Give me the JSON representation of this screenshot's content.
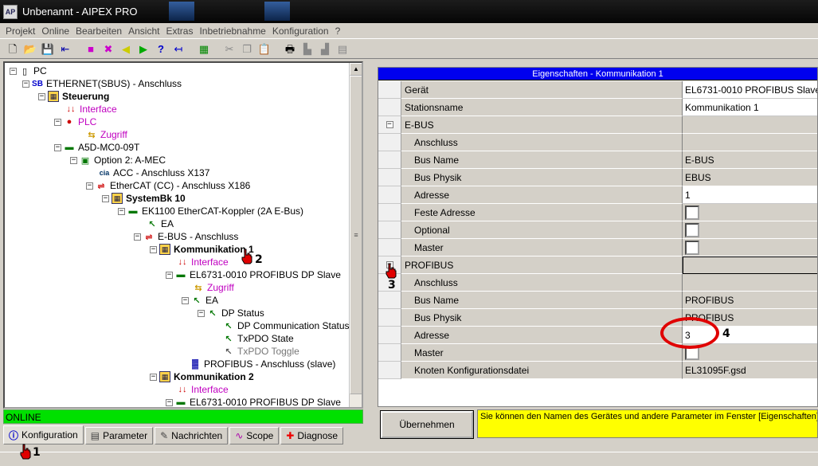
{
  "window": {
    "title": "Unbenannt - AIPEX PRO",
    "app_icon": "AP"
  },
  "menu": [
    "Projekt",
    "Online",
    "Bearbeiten",
    "Ansicht",
    "Extras",
    "Inbetriebnahme",
    "Konfiguration",
    "?"
  ],
  "toolbar_icons": [
    "new-icon",
    "open-icon",
    "save-icon",
    "import-icon",
    "disk-magenta-icon",
    "delete-icon",
    "arrow-left-icon",
    "arrow-right-icon",
    "help-icon",
    "cut-arrow-icon",
    "calculator-icon",
    "scissors-icon",
    "copy-icon",
    "paste-icon",
    "print-icon",
    "align-icon",
    "align2-icon",
    "align3-icon"
  ],
  "tree": [
    {
      "label": "PC",
      "icon": "pc-icon"
    },
    {
      "label": "ETHERNET(SBUS) - Anschluss",
      "icon": "sb-icon"
    },
    {
      "label": "Steuerung",
      "icon": "controller-icon"
    },
    {
      "label": "Interface",
      "icon": "interface-icon"
    },
    {
      "label": "PLC",
      "icon": "plc-icon"
    },
    {
      "label": "Zugriff",
      "icon": "access-icon"
    },
    {
      "label": "A5D-MC0-09T",
      "icon": "module-icon"
    },
    {
      "label": "Option 2: A-MEC",
      "icon": "option-icon"
    },
    {
      "label": "ACC - Anschluss X137",
      "icon": "cia-icon"
    },
    {
      "label": "EtherCAT (CC) - Anschluss X186",
      "icon": "ethercat-icon"
    },
    {
      "label": "SystemBk 10",
      "icon": "systembk-icon"
    },
    {
      "label": "EK1100 EtherCAT-Koppler (2A E-Bus)",
      "icon": "module-icon"
    },
    {
      "label": "EA",
      "icon": "io-icon"
    },
    {
      "label": "E-BUS - Anschluss",
      "icon": "ebus-icon"
    },
    {
      "label": "Kommunikation 1",
      "icon": "controller-icon"
    },
    {
      "label": "Interface",
      "icon": "interface-icon"
    },
    {
      "label": "EL6731-0010 PROFIBUS DP Slave",
      "icon": "module-icon"
    },
    {
      "label": "Zugriff",
      "icon": "access-icon"
    },
    {
      "label": "EA",
      "icon": "io-icon"
    },
    {
      "label": "DP Status",
      "icon": "io-icon"
    },
    {
      "label": "DP Communication Status",
      "icon": "io-icon"
    },
    {
      "label": "TxPDO State",
      "icon": "io-icon"
    },
    {
      "label": "TxPDO Toggle",
      "icon": "io-icon"
    },
    {
      "label": "PROFIBUS - Anschluss  (slave)",
      "icon": "profibus-icon"
    },
    {
      "label": "Kommunikation 2",
      "icon": "controller-icon"
    },
    {
      "label": "Interface",
      "icon": "interface-icon"
    },
    {
      "label": "EL6731-0010 PROFIBUS DP Slave",
      "icon": "module-icon"
    }
  ],
  "status": "ONLINE",
  "tabs": [
    {
      "label": "Konfiguration",
      "icon": "info-icon",
      "active": true
    },
    {
      "label": "Parameter",
      "icon": "parameter-icon",
      "active": false
    },
    {
      "label": "Nachrichten",
      "icon": "messages-icon",
      "active": false
    },
    {
      "label": "Scope",
      "icon": "scope-icon",
      "active": false
    },
    {
      "label": "Diagnose",
      "icon": "diagnose-icon",
      "active": false
    }
  ],
  "properties": {
    "title": "Eigenschaften - Kommunikation 1",
    "rows": [
      {
        "label": "Gerät",
        "value": "EL6731-0010 PROFIBUS Slave"
      },
      {
        "label": "Stationsname",
        "value": "Kommunikation 1"
      },
      {
        "label": "E-BUS",
        "value": ""
      },
      {
        "label": "Anschluss",
        "value": ""
      },
      {
        "label": "Bus Name",
        "value": "E-BUS"
      },
      {
        "label": "Bus Physik",
        "value": "EBUS"
      },
      {
        "label": "Adresse",
        "value": "1"
      },
      {
        "label": "Feste Adresse",
        "value": ""
      },
      {
        "label": "Optional",
        "value": ""
      },
      {
        "label": "Master",
        "value": ""
      },
      {
        "label": "PROFIBUS",
        "value": ""
      },
      {
        "label": "Anschluss",
        "value": ""
      },
      {
        "label": "Bus Name",
        "value": "PROFIBUS"
      },
      {
        "label": "Bus Physik",
        "value": "PROFIBUS"
      },
      {
        "label": "Adresse",
        "value": "3"
      },
      {
        "label": "Master",
        "value": ""
      },
      {
        "label": "Knoten Konfigurationsdatei",
        "value": "EL31095F.gsd"
      }
    ]
  },
  "apply_button": "Übernehmen",
  "hint": "Sie können den Namen des Gerätes und andere Parameter im Fenster [Eigenschaften] än",
  "annotations": [
    "1",
    "2",
    "3",
    "4"
  ],
  "colors": {
    "status_green": "#00e000",
    "title_blue": "#0000ee",
    "hint_yellow": "#ffff00",
    "annotation_red": "#e00000"
  }
}
